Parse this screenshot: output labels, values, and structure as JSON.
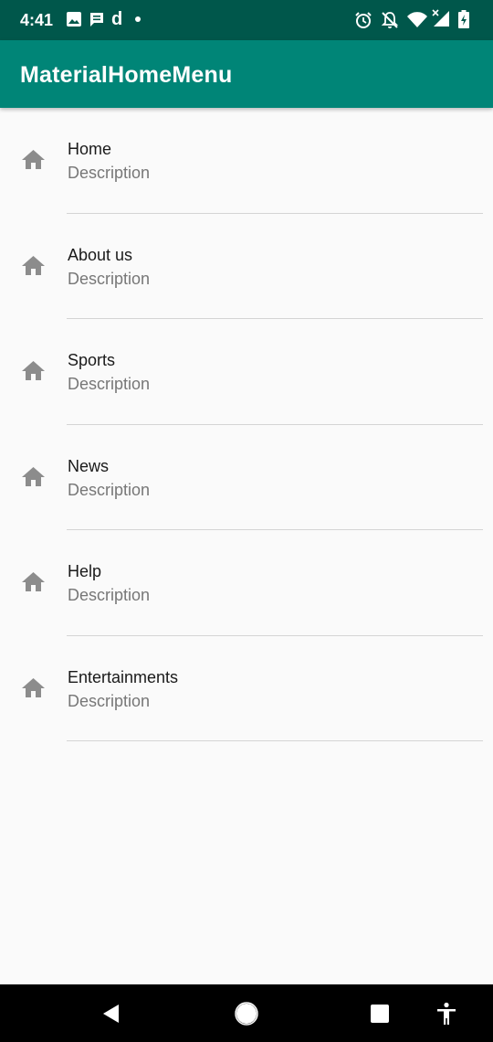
{
  "status_bar": {
    "time": "4:41",
    "notification_letter": "d",
    "icons": [
      "image-icon",
      "message-icon",
      "alarm-icon",
      "notifications-off-icon",
      "wifi-icon",
      "signal-icon",
      "battery-charging-icon"
    ]
  },
  "app_bar": {
    "title": "MaterialHomeMenu"
  },
  "menu": {
    "items": [
      {
        "title": "Home",
        "description": "Description",
        "icon": "home-icon"
      },
      {
        "title": "About us",
        "description": "Description",
        "icon": "home-icon"
      },
      {
        "title": "Sports",
        "description": "Description",
        "icon": "home-icon"
      },
      {
        "title": "News",
        "description": "Description",
        "icon": "home-icon"
      },
      {
        "title": "Help",
        "description": "Description",
        "icon": "home-icon"
      },
      {
        "title": "Entertainments",
        "description": "Description",
        "icon": "home-icon"
      }
    ]
  },
  "nav_bar": {
    "buttons": [
      "back-icon",
      "home-circle-icon",
      "recents-icon",
      "accessibility-icon"
    ]
  },
  "colors": {
    "status_bar": "#00574b",
    "app_bar": "#008577",
    "background": "#fafafa",
    "icon": "#8c8c8c",
    "title_text": "#1a1a1a",
    "description_text": "#777777",
    "divider": "#d4d4d4"
  }
}
